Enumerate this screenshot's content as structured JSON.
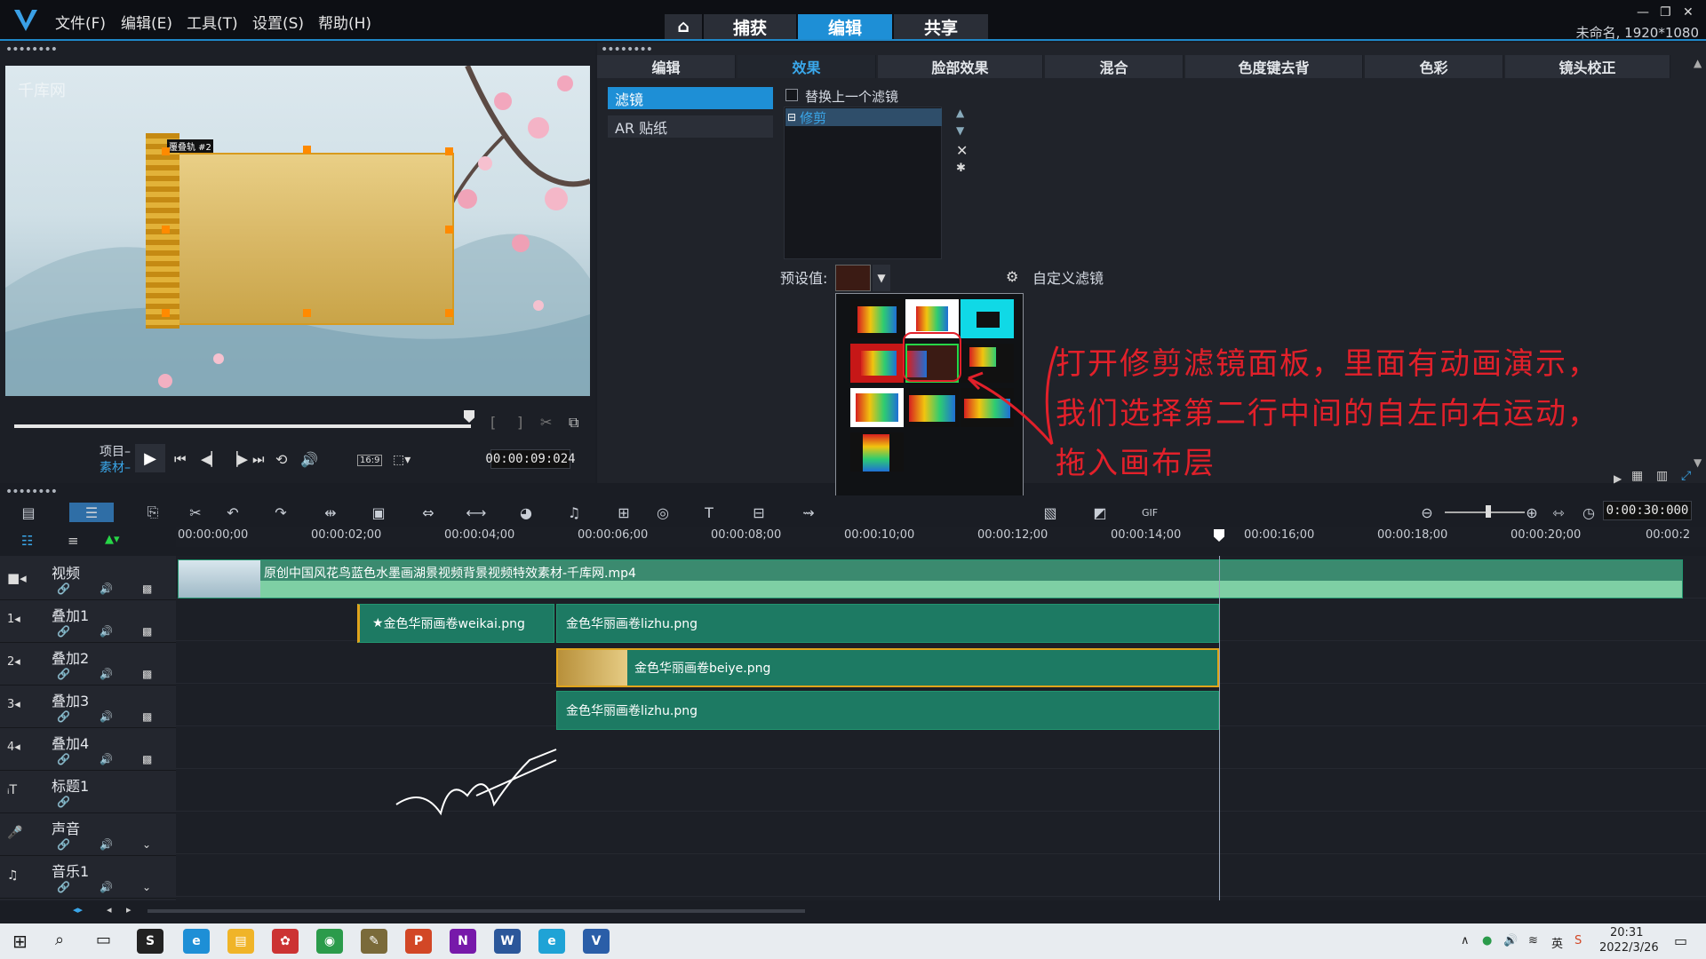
{
  "menubar": {
    "file": "文件(F)",
    "edit": "编辑(E)",
    "tools": "工具(T)",
    "settings": "设置(S)",
    "help": "帮助(H)"
  },
  "main_tabs": {
    "capture": "捕获",
    "edit": "编辑",
    "share": "共享"
  },
  "project_name": "未命名, 1920*1080",
  "effect_tabs": [
    "编辑",
    "效果",
    "脸部效果",
    "混合",
    "色度键去背",
    "色彩",
    "镜头校正"
  ],
  "categories": {
    "filter": "滤镜",
    "ar": "AR 贴纸"
  },
  "replace_prev_filter": "替换上一个滤镜",
  "applied_filter": "修剪",
  "preset_label": "预设值:",
  "custom_filter": "自定义滤镜",
  "preview": {
    "watermark": "千库网",
    "project_label": "项目",
    "clip_label": "素材",
    "timecode": "00:00:09:024",
    "aspect": "16:9",
    "object_label": "覆叠轨 #2"
  },
  "timeline": {
    "total_time": "0:00:30:000",
    "ruler": [
      "00:00:00;00",
      "00:00:02;00",
      "00:00:04;00",
      "00:00:06;00",
      "00:00:08;00",
      "00:00:10;00",
      "00:00:12;00",
      "00:00:14;00",
      "00:00:16;00",
      "00:00:18;00",
      "00:00:20;00",
      "00:00:2"
    ],
    "tracks": [
      "视频",
      "叠加1",
      "叠加2",
      "叠加3",
      "叠加4",
      "标题1",
      "声音",
      "音乐1"
    ],
    "clips": {
      "video": "原创中国风花鸟蓝色水墨画湖景视频背景视频特效素材-千库网.mp4",
      "o1a": "金色华丽画卷weikai.png",
      "o1b": "金色华丽画卷lizhu.png",
      "o2": "金色华丽画卷beiye.png",
      "o3": "金色华丽画卷lizhu.png"
    }
  },
  "annotation": [
    "打开修剪滤镜面板，里面有动画演示，",
    "我们选择第二行中间的自左向右运动，",
    "拖入画布层"
  ],
  "taskbar": {
    "time": "20:31",
    "date": "2022/3/26"
  },
  "colors": {
    "accent": "#1e8fd6",
    "clip": "#1d7a63",
    "annotation": "#e2202a"
  }
}
